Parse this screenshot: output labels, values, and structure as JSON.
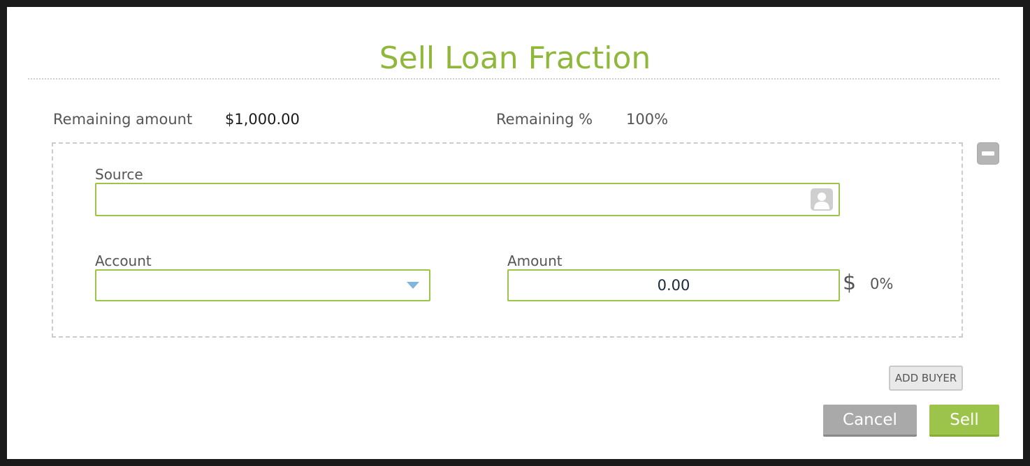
{
  "dialog": {
    "title": "Sell Loan Fraction"
  },
  "summary": {
    "remaining_amount_label": "Remaining amount",
    "remaining_amount_value": "$1,000.00",
    "remaining_pct_label": "Remaining %",
    "remaining_pct_value": "100%"
  },
  "buyer": {
    "source_label": "Source",
    "source_value": "",
    "account_label": "Account",
    "account_value": "",
    "amount_label": "Amount",
    "amount_value": "0.00",
    "currency_symbol": "$",
    "percent_value": "0%"
  },
  "actions": {
    "add_buyer_label": "ADD BUYER",
    "cancel_label": "Cancel",
    "sell_label": "Sell"
  },
  "icons": {
    "remove_buyer": "minus-icon",
    "source_lookup": "person-icon",
    "account_dropdown": "caret-down-icon"
  },
  "colors": {
    "accent": "#9cc44a",
    "title": "#8fb83a",
    "cancel": "#a9a9a9",
    "dropdown_caret": "#7fb6dc"
  }
}
